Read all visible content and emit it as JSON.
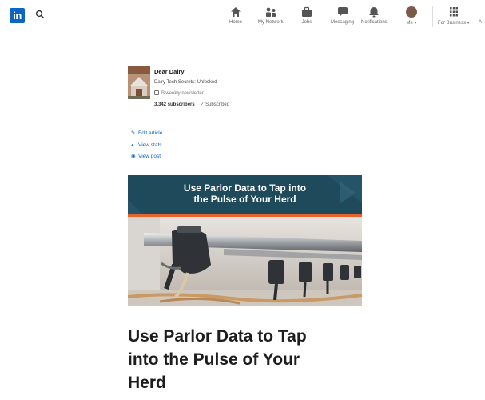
{
  "nav": {
    "logo_text": "in",
    "items": [
      {
        "label": "Home",
        "icon": "home-icon"
      },
      {
        "label": "My Network",
        "icon": "network-icon"
      },
      {
        "label": "Jobs",
        "icon": "jobs-icon"
      },
      {
        "label": "Messaging",
        "icon": "messaging-icon"
      },
      {
        "label": "Notifications",
        "icon": "notifications-icon"
      },
      {
        "label": "Me ▾",
        "icon": "avatar"
      },
      {
        "label": "For Business ▾",
        "icon": "grid-icon"
      },
      {
        "label": "A",
        "icon": ""
      }
    ]
  },
  "newsletter": {
    "title": "Dear Dairy",
    "subtitle": "Dairy Tech Secrets: Unlocked",
    "frequency": "Biweekly newsletter",
    "subscriber_count": "3,342 subscribers",
    "subscribed_label": "✓ Subscribed"
  },
  "actions": {
    "edit": "Edit article",
    "stats": "View stats",
    "post": "View post"
  },
  "hero": {
    "line1": "Use Parlor Data to Tap into",
    "line2": "the Pulse of Your Herd",
    "band_color": "#1f4a5c",
    "stripe_color": "#e8632b"
  },
  "article": {
    "title_line1": "Use Parlor Data to Tap",
    "title_line2": "into the Pulse of Your",
    "title_line3": "Herd"
  }
}
